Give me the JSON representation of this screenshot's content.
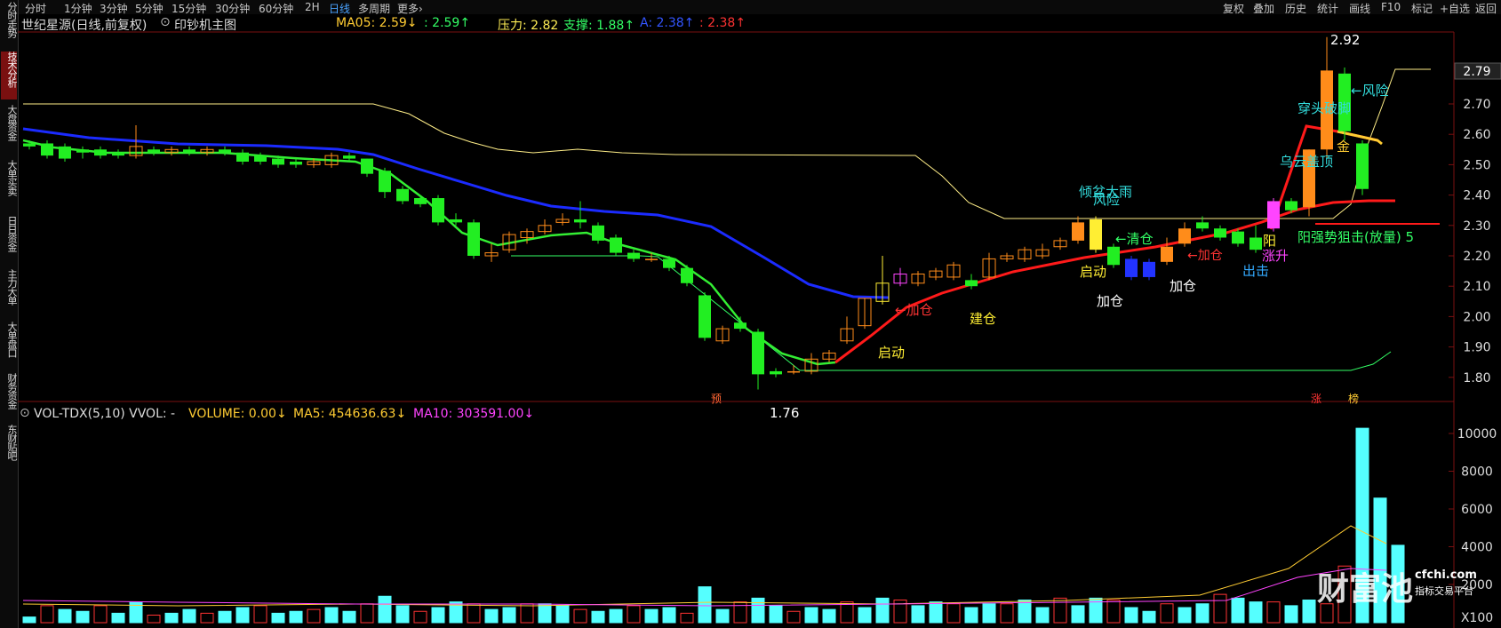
{
  "toolbar": {
    "periods": [
      "分时",
      "1分钟",
      "3分钟",
      "5分钟",
      "15分钟",
      "30分钟",
      "60分钟",
      "2H",
      "日线",
      "多周期",
      "更多›"
    ],
    "right_buttons": [
      "复权",
      "叠加",
      "历史",
      "统计",
      "画线",
      "F10",
      "标记",
      "+自选",
      "返回"
    ]
  },
  "sidebar": [
    "分时走势",
    "技术分析",
    "大盘资金",
    "大单买卖",
    "日日资金",
    "主力大单",
    "大单盘口",
    "财务资金",
    "东财贴吧"
  ],
  "main_header": {
    "title": "世纪星源(日线,前复权)",
    "indicator": "印钞机主图",
    "ma05": "MA05: 2.59↓",
    "ma05b": ": 2.59↑",
    "pressure": "压力: 2.82",
    "support": "支撑: 1.88↑",
    "a_val": "A: 2.38↑",
    "a_val2": ": 2.38↑"
  },
  "vol_header": {
    "name": "VOL-TDX(5,10) VVOL: -",
    "volume": "VOLUME: 0.00↓",
    "ma5": "MA5: 454636.63↓",
    "ma10": "MA10: 303591.00↓"
  },
  "price_axis": [
    "2.70",
    "2.60",
    "2.50",
    "2.40",
    "2.30",
    "2.20",
    "2.10",
    "2.00",
    "1.90",
    "1.80"
  ],
  "price_current": "2.79",
  "vol_axis": [
    "10000",
    "8000",
    "6000",
    "4000",
    "2000"
  ],
  "vol_unit": "X100",
  "annotations": {
    "high": "2.92",
    "low": "1.76",
    "risk1": "←风险",
    "chuantou": "穿头破脚",
    "wuyun": "乌云盖顶",
    "jin": "金",
    "qingpen": "倾盆大雨",
    "fengxian": "风险",
    "qingcang": "←清仓",
    "qidong1": "启动",
    "qidong2": "启动",
    "jiacang_red": "←加仓",
    "jiancang": "建仓",
    "jiacang1": "加仓",
    "jiacang2": "加仓",
    "jiacang_red2": "←加仓",
    "chuji": "出击",
    "zhangsheng": "涨升",
    "yang": "阳",
    "qiangshi": "阳强势狙击(放量) 5",
    "yu": "预",
    "zhang": "涨",
    "bang": "榜"
  },
  "logo": {
    "brand": "财富池",
    "site": "cfchi.com",
    "sub": "指标交易平台"
  },
  "colors": {
    "up": "#ff8c1a",
    "down": "#22ee22",
    "ma_blue": "#1b2bff",
    "ma_red": "#ff1a1a",
    "vol": "#55ffff"
  }
}
